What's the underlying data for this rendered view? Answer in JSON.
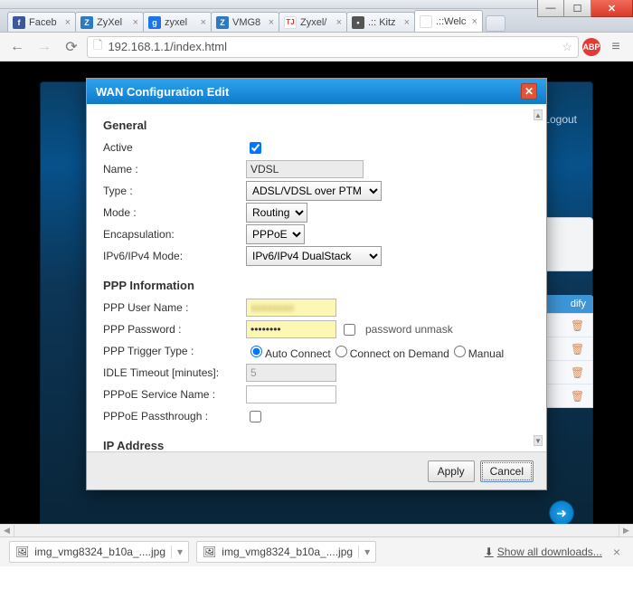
{
  "window": {
    "tabs": [
      {
        "label": "Faceb",
        "favicon_bg": "#3b5998",
        "favicon_text": "f"
      },
      {
        "label": "ZyXel",
        "favicon_bg": "#2d7abf",
        "favicon_text": "Z"
      },
      {
        "label": "zyxel",
        "favicon_bg": "#1a73e8",
        "favicon_text": "g"
      },
      {
        "label": "VMG8",
        "favicon_bg": "#2d7abf",
        "favicon_text": "Z"
      },
      {
        "label": "Zyxel/",
        "favicon_bg": "#cc3b2f",
        "favicon_text": "TJ"
      },
      {
        "label": ".:: Kitz",
        "favicon_bg": "#555",
        "favicon_text": "•"
      },
      {
        "label": ".::Welc",
        "favicon_bg": "#fff",
        "favicon_text": ""
      }
    ],
    "url": "192.168.1.1/index.html"
  },
  "router": {
    "logout": "Logout",
    "side_header": "dify"
  },
  "dialog": {
    "title": "WAN Configuration Edit",
    "sections": {
      "general": "General",
      "ppp": "PPP Information",
      "ip": "IP Address"
    },
    "labels": {
      "active": "Active",
      "name": "Name :",
      "type": "Type :",
      "mode": "Mode :",
      "encap": "Encapsulation:",
      "ipmode": "IPv6/IPv4 Mode:",
      "ppp_user": "PPP User Name :",
      "ppp_pass": "PPP Password :",
      "ppp_trigger": "PPP Trigger Type :",
      "idle": "IDLE Timeout [minutes]:",
      "svc": "PPPoE Service Name :",
      "pass": "PPPoE Passthrough :"
    },
    "values": {
      "active": true,
      "name": "VDSL",
      "type": "ADSL/VDSL over PTM",
      "mode": "Routing",
      "encap": "PPPoE",
      "ipmode": "IPv6/IPv4 DualStack",
      "ppp_user": "",
      "ppp_pass": "••••••••",
      "unmask_label": "password unmask",
      "trigger_opts": {
        "auto": "Auto Connect",
        "demand": "Connect on Demand",
        "manual": "Manual"
      },
      "trigger_sel": "auto",
      "idle": "5",
      "svc": "",
      "pass": false
    },
    "buttons": {
      "apply": "Apply",
      "cancel": "Cancel"
    }
  },
  "downloads": {
    "items": [
      "img_vmg8324_b10a_....jpg",
      "img_vmg8324_b10a_....jpg"
    ],
    "show_all": "Show all downloads..."
  }
}
